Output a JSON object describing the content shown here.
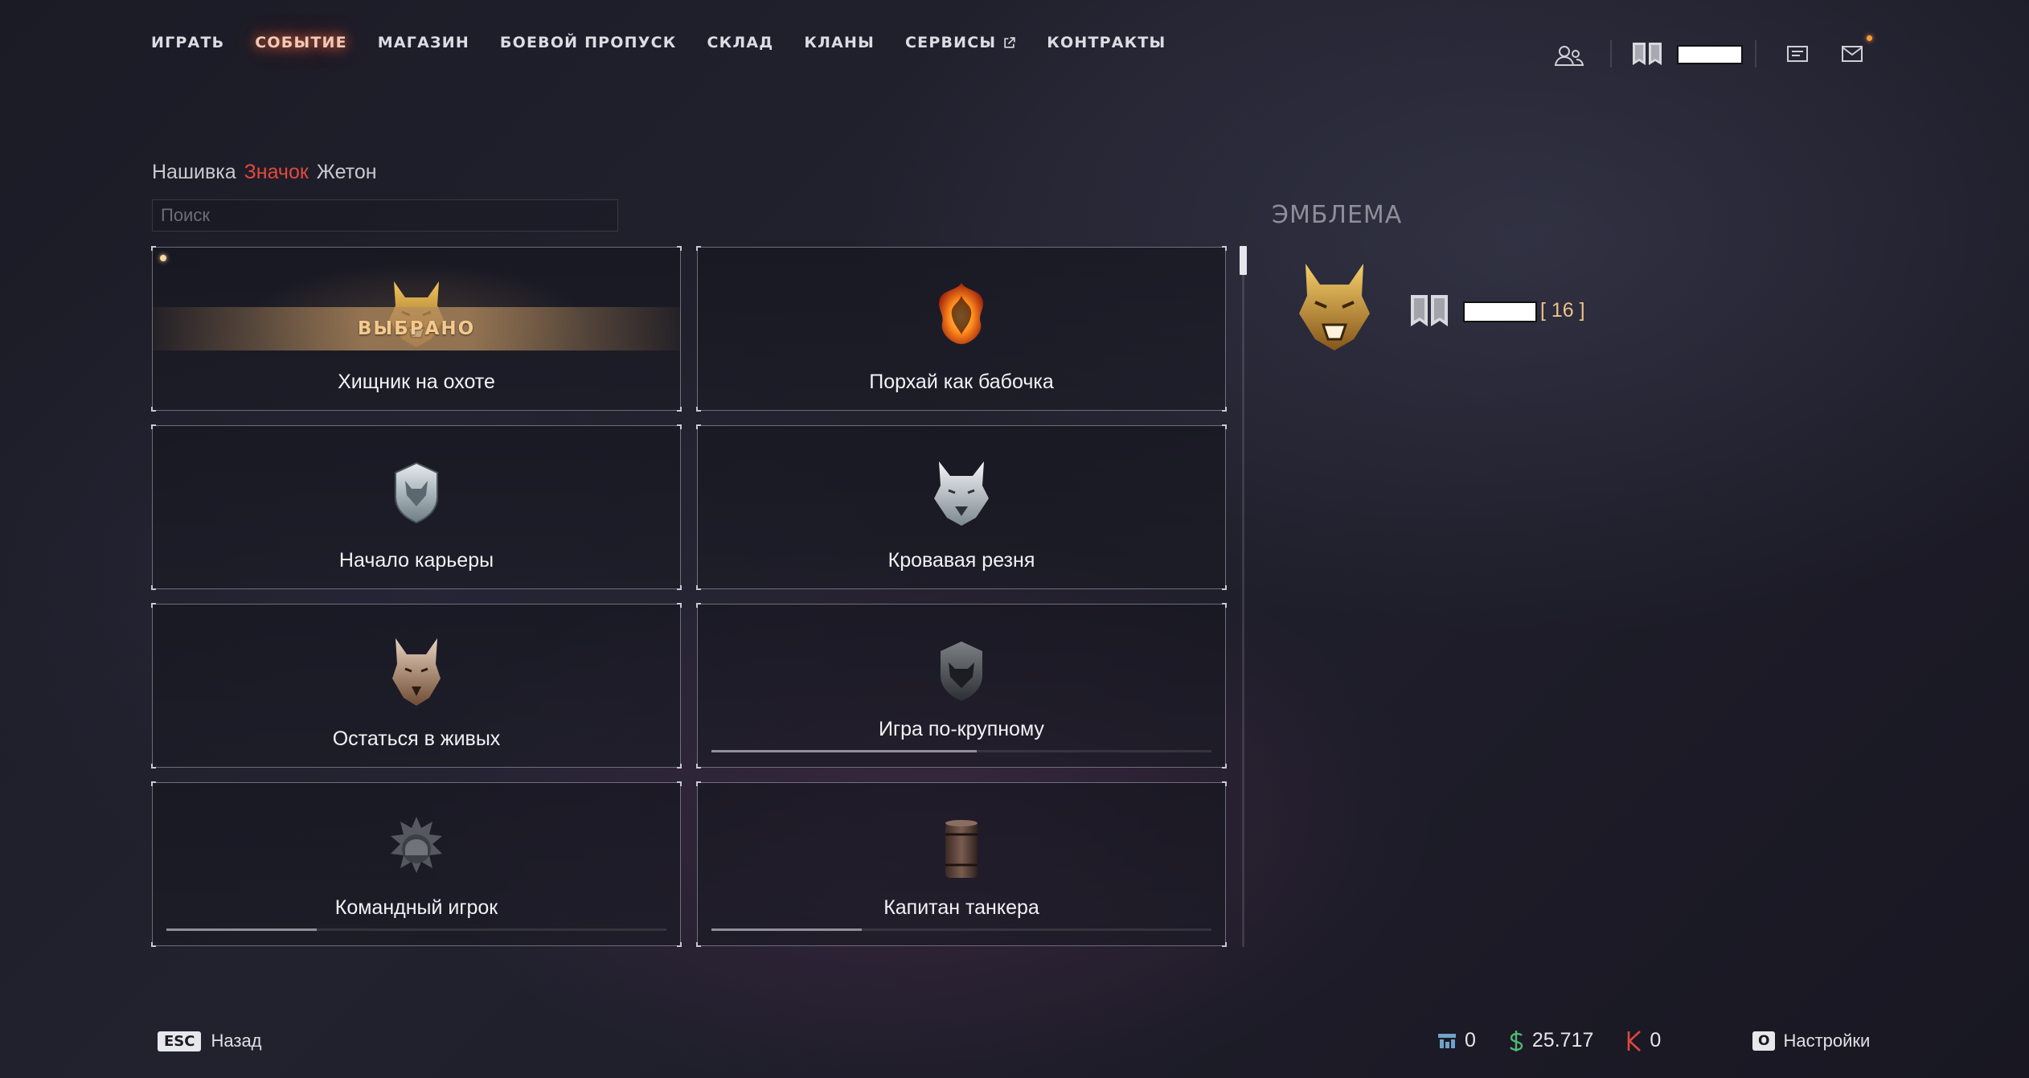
{
  "nav": {
    "items": [
      {
        "label": "ИГРАТЬ"
      },
      {
        "label": "СОБЫТИЕ",
        "active": true
      },
      {
        "label": "МАГАЗИН"
      },
      {
        "label": "БОЕВОЙ ПРОПУСК"
      },
      {
        "label": "СКЛАД"
      },
      {
        "label": "КЛАНЫ"
      },
      {
        "label": "СЕРВИСЫ",
        "external": true
      },
      {
        "label": "КОНТРАКТЫ"
      }
    ]
  },
  "tabs": {
    "items": [
      "Нашивка",
      "Значок",
      "Жетон"
    ],
    "active": "Значок"
  },
  "search": {
    "placeholder": "Поиск",
    "value": ""
  },
  "cards": [
    {
      "title": "Хищник на охоте",
      "icon": "golden-wolf-badge",
      "selected": true,
      "selected_label": "ВЫБРАНО"
    },
    {
      "title": "Порхай как бабочка",
      "icon": "fire-butterfly-badge"
    },
    {
      "title": "Начало карьеры",
      "icon": "silver-wolf-shield-badge"
    },
    {
      "title": "Кровавая резня",
      "icon": "white-wolf-badge"
    },
    {
      "title": "Остаться в живых",
      "icon": "bronze-wolf-badge"
    },
    {
      "title": "Игра по-крупному",
      "icon": "dark-wolf-badge",
      "progress": 0.53
    },
    {
      "title": "Командный игрок",
      "icon": "spiked-helmet-badge",
      "progress": 0.3
    },
    {
      "title": "Капитан танкера",
      "icon": "barrel-badge",
      "progress": 0.3
    }
  ],
  "emblem": {
    "heading": "ЭМБЛЕМА",
    "level": "[ 16 ]",
    "icon": "golden-wolf-emblem"
  },
  "bottom": {
    "back_key": "ESC",
    "back_label": "Назад",
    "currencies": [
      {
        "icon": "stats-icon",
        "value": "0",
        "color": "#6fa3c9"
      },
      {
        "icon": "dollar-icon",
        "value": "25.717",
        "color": "#4fb870"
      },
      {
        "icon": "k-currency-icon",
        "value": "0",
        "color": "#e0473d"
      }
    ],
    "settings_key": "O",
    "settings_label": "Настройки"
  },
  "colors": {
    "accent": "#e04a3e",
    "selected_gold": "#f4c98d",
    "nav_active_glow": "#ff6e3c"
  }
}
